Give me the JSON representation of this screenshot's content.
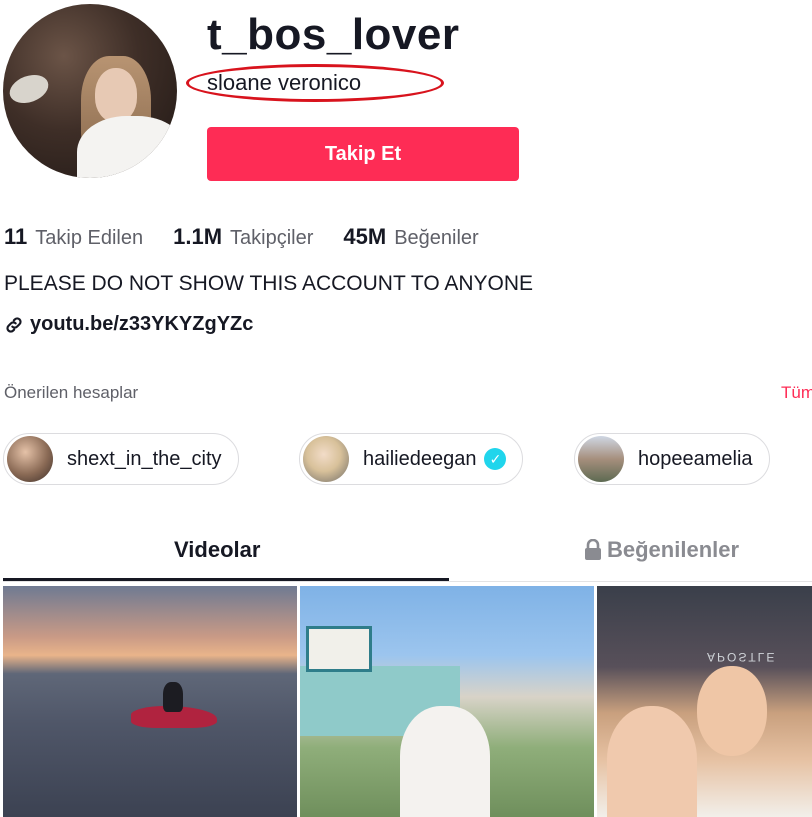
{
  "profile": {
    "username": "t_bos_lover",
    "display_name": "sloane veronico",
    "follow_label": "Takip Et",
    "bio": "PLEASE DO NOT SHOW THIS ACCOUNT TO ANYONE",
    "link": "youtu.be/z33YKYZgYZc"
  },
  "stats": [
    {
      "value": "11",
      "label": "Takip Edilen"
    },
    {
      "value": "1.1M",
      "label": "Takipçiler"
    },
    {
      "value": "45M",
      "label": "Beğeniler"
    }
  ],
  "suggested": {
    "title": "Önerilen hesaplar",
    "see_all": "Tüm",
    "accounts": [
      {
        "name": "shext_in_the_city",
        "verified": false
      },
      {
        "name": "hailiedeegan",
        "verified": true
      },
      {
        "name": "hopeeamelia",
        "verified": false
      }
    ]
  },
  "tabs": {
    "videos": "Videolar",
    "liked": "Beğenilenler"
  },
  "thumbnails": {
    "poster_text": "APOSTLE"
  },
  "colors": {
    "accent": "#fe2c55",
    "verified": "#20d5ec",
    "annotation": "#d8131d"
  }
}
